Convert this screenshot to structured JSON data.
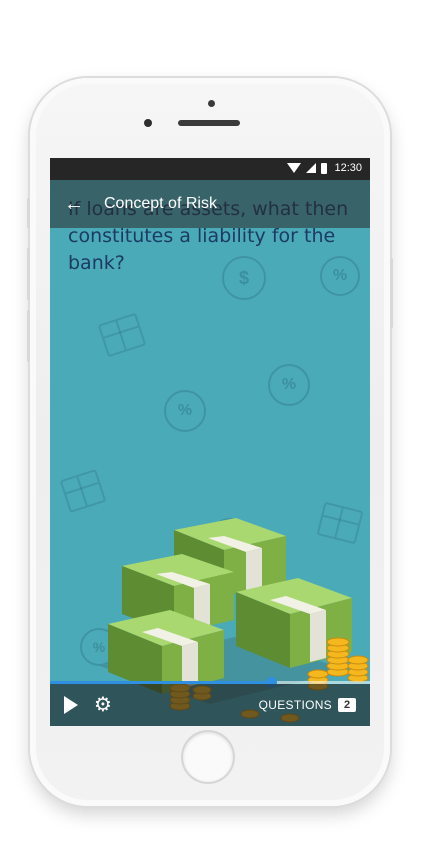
{
  "status_bar": {
    "time": "12:30"
  },
  "app_bar": {
    "title": "Concept of Risk",
    "back_icon": "arrow-left-icon"
  },
  "content": {
    "question": "If loans are assets, what then constitutes a liability for the bank?"
  },
  "player": {
    "progress": 0.69,
    "play_icon": "play-icon",
    "settings_icon": "gear-icon",
    "questions_label": "QUESTIONS",
    "questions_count": "2"
  },
  "colors": {
    "screen_bg": "#4aaab8",
    "question_text": "#1d3a63",
    "progress": "#2f8fe0"
  }
}
